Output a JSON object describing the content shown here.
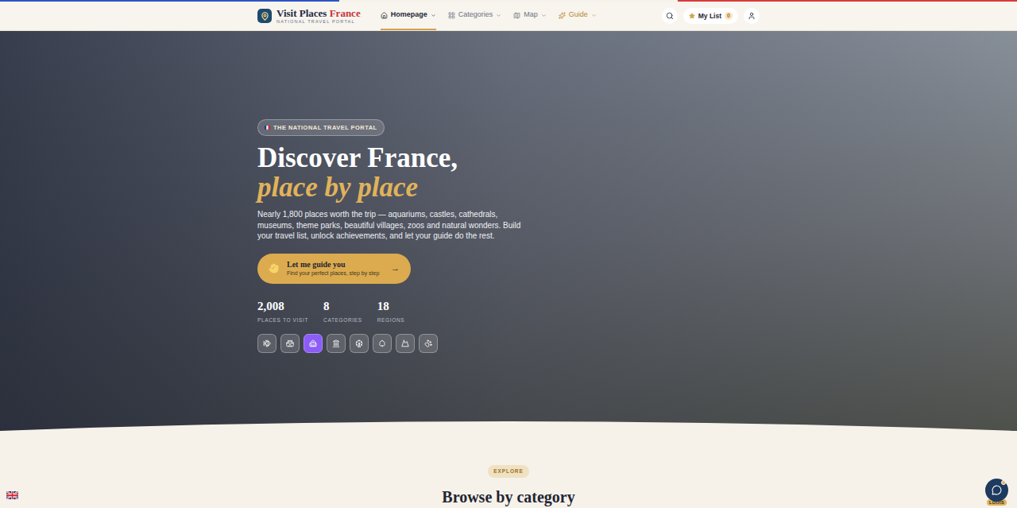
{
  "header": {
    "logo": {
      "title": "Visit Places ",
      "title_accent": "France",
      "subtitle": "NATIONAL TRAVEL PORTAL"
    },
    "nav": [
      {
        "label": "Homepage",
        "selected": true,
        "color": "#1f2937"
      },
      {
        "label": "Categories",
        "selected": false,
        "color": "#6b7280"
      },
      {
        "label": "Map",
        "selected": false,
        "color": "#6b7280"
      },
      {
        "label": "Guide",
        "selected": false,
        "color": "#b8862f"
      }
    ],
    "my_list": {
      "label": "My List",
      "count": "0"
    }
  },
  "hero": {
    "badge": "THE NATIONAL TRAVEL PORTAL",
    "title": "Discover France,",
    "title_accent": "place by place",
    "description": "Nearly 1,800 places worth the trip — aquariums, castles, cathedrals, museums, theme parks, beautiful villages, zoos and natural wonders. Build your travel list, unlock achievements, and let your guide do the rest.",
    "cta": {
      "title": "Let me guide you",
      "subtitle": "Find your perfect places, step by step",
      "arrow": "→"
    },
    "stats": [
      {
        "value": "2,008",
        "label": "PLACES TO VISIT"
      },
      {
        "value": "8",
        "label": "CATEGORIES"
      },
      {
        "value": "18",
        "label": "REGIONS"
      }
    ],
    "categories": [
      {
        "selected": false
      },
      {
        "selected": false
      },
      {
        "selected": true
      },
      {
        "selected": false
      },
      {
        "selected": false
      },
      {
        "selected": false
      },
      {
        "selected": false
      },
      {
        "selected": false
      }
    ]
  },
  "section": {
    "eyebrow": "EXPLORE",
    "title": "Browse by category"
  },
  "chat": {
    "label": "LOUIS"
  }
}
